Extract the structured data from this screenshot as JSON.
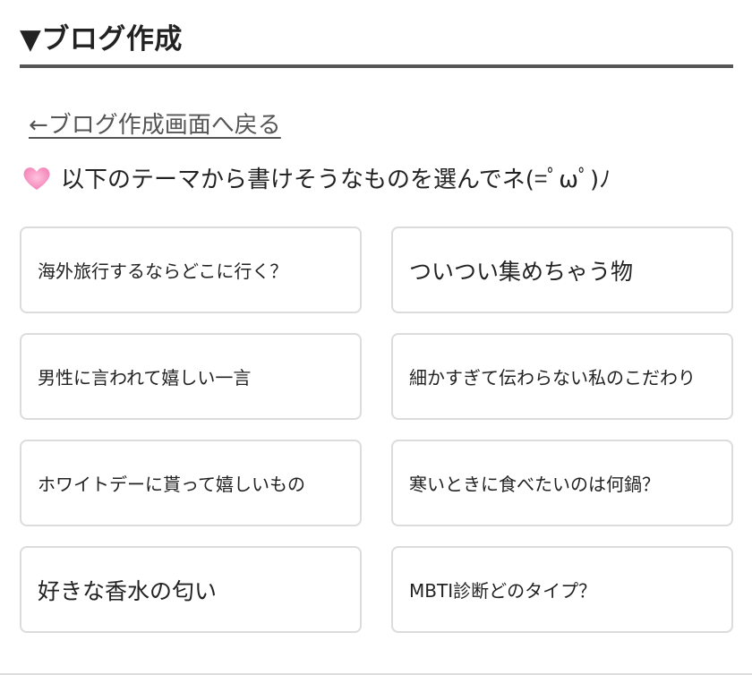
{
  "header": {
    "title": "▼ブログ作成"
  },
  "back_link": {
    "label": "←ブログ作成画面へ戻る"
  },
  "prompt": {
    "icon": "heart-icon",
    "text": "以下のテーマから書けそうなものを選んでネ(=ﾟωﾟ)ﾉ"
  },
  "themes": [
    {
      "label": "海外旅行するならどこに行く？"
    },
    {
      "label": "ついつい集めちゃう物"
    },
    {
      "label": "男性に言われて嬉しい一言"
    },
    {
      "label": "細かすぎて伝わらない私のこだわり"
    },
    {
      "label": "ホワイトデーに貰って嬉しいもの"
    },
    {
      "label": "寒いときに食べたいのは何鍋？"
    },
    {
      "label": "好きな香水の匂い"
    },
    {
      "label": "MBTI診断どのタイプ？"
    }
  ],
  "colors": {
    "heart": "#f59ac6",
    "rule": "#555555",
    "card_border": "#dcdcdc",
    "text": "#222222"
  }
}
